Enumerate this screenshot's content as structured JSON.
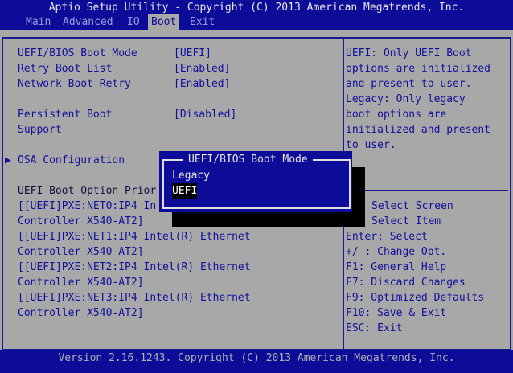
{
  "header": {
    "title": "Aptio Setup Utility - Copyright (C) 2013 American Megatrends, Inc.",
    "tabs": [
      {
        "label": "Main"
      },
      {
        "label": "Advanced"
      },
      {
        "label": "IO"
      },
      {
        "label": "Boot"
      },
      {
        "label": "Exit"
      }
    ],
    "active_tab": "Boot"
  },
  "settings": [
    {
      "label": "UEFI/BIOS Boot Mode",
      "value": "[UEFI]"
    },
    {
      "label": "Retry Boot List",
      "value": "[Enabled]"
    },
    {
      "label": "Network Boot Retry",
      "value": "[Enabled]"
    },
    {
      "label": "Persistent Boot",
      "label2": "Support",
      "value": "[Disabled]"
    }
  ],
  "submenu": {
    "label": "OSA Configuration"
  },
  "boot_priority": {
    "heading": "UEFI Boot Option Prior",
    "items": [
      {
        "line1": "[[UEFI]PXE:NET0:IP4 In",
        "line2": "Controller X540-AT2]"
      },
      {
        "line1": "[[UEFI]PXE:NET1:IP4 Intel(R) Ethernet",
        "line2": "Controller X540-AT2]"
      },
      {
        "line1": "[[UEFI]PXE:NET2:IP4 Intel(R) Ethernet",
        "line2": "Controller X540-AT2]"
      },
      {
        "line1": "[[UEFI]PXE:NET3:IP4 Intel(R) Ethernet",
        "line2": "Controller X540-AT2]"
      }
    ]
  },
  "help": [
    "UEFI: Only UEFI Boot",
    "options are initialized",
    "and present to user.",
    "Legacy: Only legacy",
    "boot options are",
    "initialized and present",
    "to user."
  ],
  "keys": [
    "Select Screen",
    "Select Item",
    "Enter: Select",
    "+/-: Change Opt.",
    "F1: General Help",
    "F7: Discard Changes",
    "F9: Optimized Defaults",
    "F10: Save & Exit",
    "ESC: Exit"
  ],
  "popup": {
    "title": "UEFI/BIOS Boot Mode",
    "options": [
      {
        "label": "Legacy"
      },
      {
        "label": "UEFI"
      }
    ],
    "selected": "UEFI"
  },
  "footer": "Version 2.16.1243. Copyright (C) 2013 American Megatrends, Inc."
}
